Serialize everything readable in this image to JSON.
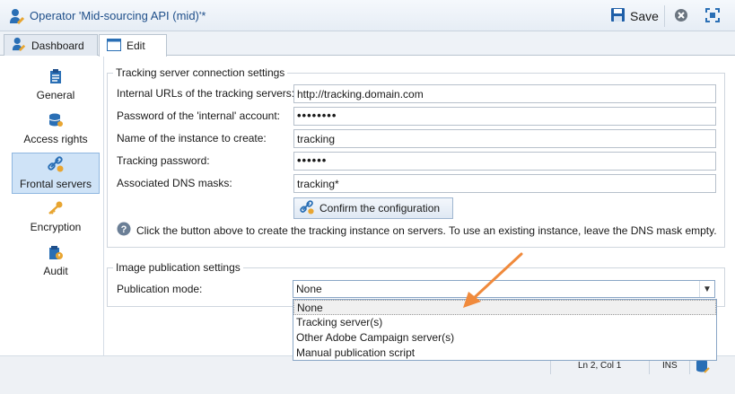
{
  "window": {
    "title": "Operator 'Mid-sourcing API (mid)'*",
    "save_label": "Save"
  },
  "tabs": [
    {
      "label": "Dashboard",
      "icon": "operator-icon"
    },
    {
      "label": "Edit",
      "icon": "window-icon",
      "active": true
    }
  ],
  "sidebar": {
    "items": [
      {
        "label": "General",
        "icon": "clipboard-icon"
      },
      {
        "label": "Access rights",
        "icon": "database-icon"
      },
      {
        "label": "Frontal servers",
        "icon": "linked-servers-icon",
        "active": true
      },
      {
        "label": "Encryption",
        "icon": "key-icon"
      },
      {
        "label": "Audit",
        "icon": "audit-icon"
      }
    ]
  },
  "tracking_group": {
    "legend": "Tracking server connection settings",
    "fields": [
      {
        "label": "Internal URLs of the tracking servers:",
        "value": "http://tracking.domain.com"
      },
      {
        "label": "Password of the 'internal' account:",
        "value": "••••••••"
      },
      {
        "label": "Name of the instance to create:",
        "value": "tracking"
      },
      {
        "label": "Tracking password:",
        "value": "••••••"
      },
      {
        "label": "Associated DNS masks:",
        "value": "tracking*"
      }
    ],
    "confirm_button": "Confirm the configuration",
    "help_text": "Click the button above to create the tracking instance on servers. To use an existing instance, leave the DNS mask empty."
  },
  "image_group": {
    "legend": "Image publication settings",
    "mode_label": "Publication mode:",
    "mode_value": "None",
    "options": [
      "None",
      "Tracking server(s)",
      "Other Adobe Campaign server(s)",
      "Manual publication script"
    ]
  },
  "statusbar": {
    "position": "Ln 2, Col 1",
    "mode": "INS"
  },
  "colors": {
    "accent": "#1f4f8a",
    "annotation_arrow": "#f08a3c",
    "active_item_bg": "#cfe3f7"
  }
}
